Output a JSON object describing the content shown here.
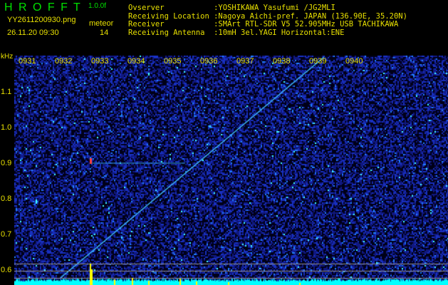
{
  "header": {
    "app_name": "H R O F F T",
    "version": "1.0.0f",
    "filename": "YY2611200930.png",
    "datetime": "26.11.20 09:30",
    "mode_label": "meteor",
    "count": "14",
    "info_lines": [
      "Ovserver           :YOSHIKAWA Yasufumi /JG2MLI",
      "Receiving Location :Nagoya Aichi-pref. JAPAN (136.90E, 35.20N)",
      "Receiver           :SMArt RTL-SDR V5 52.905MHz USB TACHIKAWA",
      "Receiving Antenna  :10mH 3el.YAGI Horizontal:ENE"
    ]
  },
  "axis": {
    "unit": "kHz",
    "time_labels": [
      "0931",
      "0932",
      "0933",
      "0934",
      "0935",
      "0936",
      "0937",
      "0938",
      "0939",
      "0940"
    ],
    "freq_labels": [
      "1.1",
      "1.0",
      "0.9",
      "0.8",
      "0.7",
      "0.6"
    ]
  },
  "colors": {
    "text_green": "#00e000",
    "text_yellow": "#e8e000",
    "noise_floor": "#00ffff",
    "background": "#000020"
  }
}
